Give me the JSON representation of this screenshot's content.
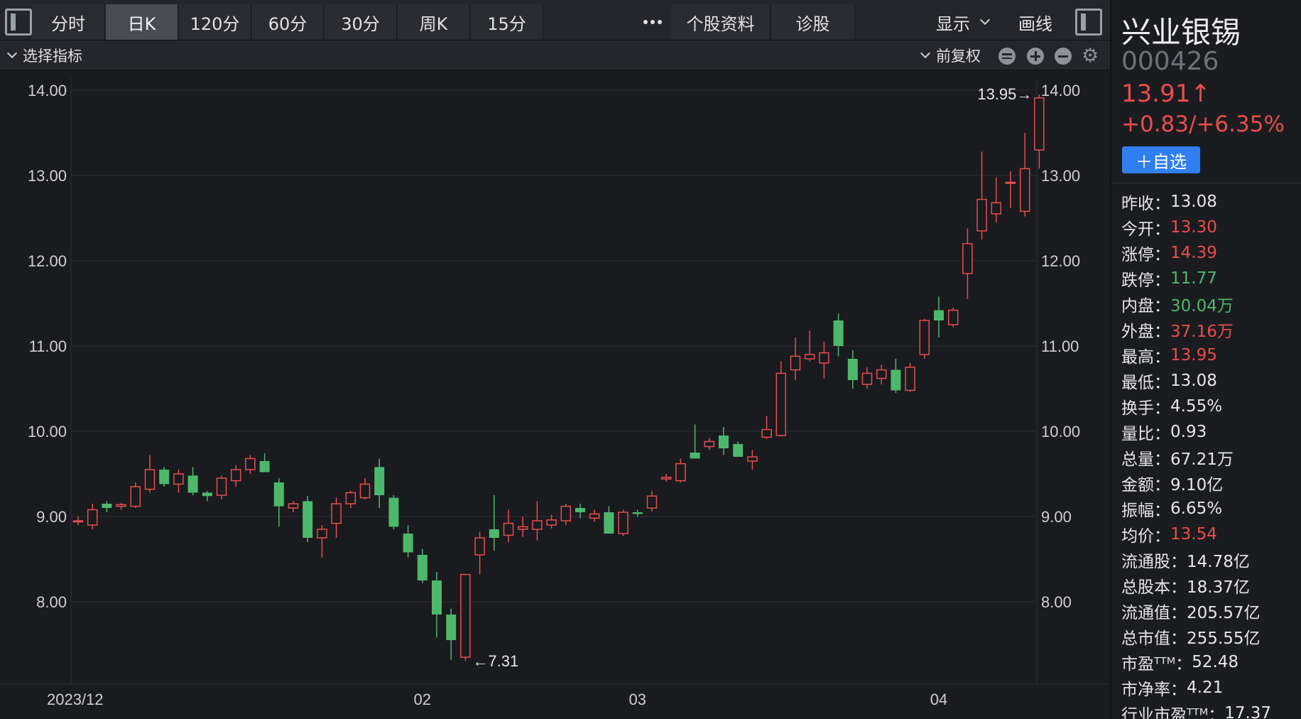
{
  "toolbar": {
    "tabs": [
      {
        "label": "分时",
        "active": false
      },
      {
        "label": "日K",
        "active": true
      },
      {
        "label": "120分",
        "active": false
      },
      {
        "label": "60分",
        "active": false
      },
      {
        "label": "30分",
        "active": false
      },
      {
        "label": "周K",
        "active": false
      },
      {
        "label": "15分",
        "active": false
      }
    ],
    "more_icon": "ellipsis-icon",
    "profile_label": "个股资料",
    "diagnose_label": "诊股",
    "display_label": "显示",
    "draw_label": "画线"
  },
  "indicator_bar": {
    "select_label": "选择指标",
    "adjust_label": "前复权",
    "icons": [
      "layers-icon",
      "zoom-in-icon",
      "zoom-out-icon",
      "gear-icon"
    ]
  },
  "stock": {
    "name": "兴业银锡",
    "code": "000426",
    "price": "13.91↑",
    "change": "+0.83/+6.35%",
    "add_watch_label": "＋自选",
    "colors": {
      "up": "#e84d4d",
      "down": "#4db86c",
      "accent": "#2f7ff0"
    }
  },
  "stats": [
    {
      "k": "昨收：",
      "v": "13.08",
      "t": "n"
    },
    {
      "k": "今开：",
      "v": "13.30",
      "t": "up"
    },
    {
      "k": "涨停：",
      "v": "14.39",
      "t": "up"
    },
    {
      "k": "跌停：",
      "v": "11.77",
      "t": "down"
    },
    {
      "k": "内盘：",
      "v": "30.04万",
      "t": "down"
    },
    {
      "k": "外盘：",
      "v": "37.16万",
      "t": "up"
    },
    {
      "k": "最高：",
      "v": "13.95",
      "t": "up"
    },
    {
      "k": "最低：",
      "v": "13.08",
      "t": "n"
    },
    {
      "k": "换手：",
      "v": "4.55%",
      "t": "n"
    },
    {
      "k": "量比：",
      "v": "0.93",
      "t": "n"
    },
    {
      "k": "总量：",
      "v": "67.21万",
      "t": "n"
    },
    {
      "k": "金额：",
      "v": "9.10亿",
      "t": "n"
    },
    {
      "k": "振幅：",
      "v": "6.65%",
      "t": "n"
    },
    {
      "k": "均价：",
      "v": "13.54",
      "t": "up"
    },
    {
      "k": "流通股：",
      "v": "14.78亿",
      "t": "n"
    },
    {
      "k": "总股本：",
      "v": "18.37亿",
      "t": "n"
    },
    {
      "k": "流通值：",
      "v": "205.57亿",
      "t": "n"
    },
    {
      "k": "总市值：",
      "v": "255.55亿",
      "t": "n"
    },
    {
      "k": "市盈ᵀᵀᴹ：",
      "v": "52.48",
      "t": "n"
    },
    {
      "k": "市净率：",
      "v": "4.21",
      "t": "n"
    },
    {
      "k": "行业市盈ᵀᵀᴹ：",
      "v": "17.37",
      "t": "n"
    }
  ],
  "chart_data": {
    "type": "candlestick",
    "ylim": [
      7.2,
      14.2
    ],
    "y_ticks": [
      "14.00",
      "13.00",
      "12.00",
      "11.00",
      "10.00",
      "9.00",
      "8.00"
    ],
    "x_labels": [
      {
        "label": "2023/12",
        "index": 0
      },
      {
        "label": "02",
        "index": 24
      },
      {
        "label": "03",
        "index": 39
      },
      {
        "label": "04",
        "index": 60
      }
    ],
    "high_label": "13.95→",
    "low_label": "←7.31",
    "colors": {
      "up": "#e84d4d",
      "down": "#4db86c"
    },
    "candles": [
      {
        "o": 8.95,
        "h": 9.0,
        "l": 8.9,
        "c": 8.95
      },
      {
        "o": 8.9,
        "h": 9.15,
        "l": 8.85,
        "c": 9.08
      },
      {
        "o": 9.15,
        "h": 9.18,
        "l": 9.05,
        "c": 9.1
      },
      {
        "o": 9.12,
        "h": 9.16,
        "l": 9.08,
        "c": 9.14
      },
      {
        "o": 9.12,
        "h": 9.4,
        "l": 9.1,
        "c": 9.35
      },
      {
        "o": 9.32,
        "h": 9.72,
        "l": 9.28,
        "c": 9.55
      },
      {
        "o": 9.55,
        "h": 9.58,
        "l": 9.35,
        "c": 9.38
      },
      {
        "o": 9.38,
        "h": 9.55,
        "l": 9.28,
        "c": 9.5
      },
      {
        "o": 9.48,
        "h": 9.58,
        "l": 9.25,
        "c": 9.28
      },
      {
        "o": 9.28,
        "h": 9.3,
        "l": 9.18,
        "c": 9.24
      },
      {
        "o": 9.25,
        "h": 9.48,
        "l": 9.2,
        "c": 9.45
      },
      {
        "o": 9.42,
        "h": 9.6,
        "l": 9.35,
        "c": 9.55
      },
      {
        "o": 9.55,
        "h": 9.72,
        "l": 9.5,
        "c": 9.68
      },
      {
        "o": 9.65,
        "h": 9.74,
        "l": 9.52,
        "c": 9.52
      },
      {
        "o": 9.4,
        "h": 9.45,
        "l": 8.88,
        "c": 9.12
      },
      {
        "o": 9.1,
        "h": 9.18,
        "l": 9.05,
        "c": 9.15
      },
      {
        "o": 9.18,
        "h": 9.24,
        "l": 8.7,
        "c": 8.75
      },
      {
        "o": 8.75,
        "h": 8.9,
        "l": 8.52,
        "c": 8.85
      },
      {
        "o": 8.92,
        "h": 9.22,
        "l": 8.75,
        "c": 9.15
      },
      {
        "o": 9.15,
        "h": 9.3,
        "l": 9.1,
        "c": 9.28
      },
      {
        "o": 9.22,
        "h": 9.45,
        "l": 9.2,
        "c": 9.38
      },
      {
        "o": 9.58,
        "h": 9.68,
        "l": 9.1,
        "c": 9.25
      },
      {
        "o": 9.22,
        "h": 9.25,
        "l": 8.85,
        "c": 8.88
      },
      {
        "o": 8.8,
        "h": 8.9,
        "l": 8.52,
        "c": 8.58
      },
      {
        "o": 8.55,
        "h": 8.62,
        "l": 8.22,
        "c": 8.25
      },
      {
        "o": 8.25,
        "h": 8.35,
        "l": 7.58,
        "c": 7.85
      },
      {
        "o": 7.85,
        "h": 7.92,
        "l": 7.32,
        "c": 7.55
      },
      {
        "o": 7.35,
        "h": 8.32,
        "l": 7.31,
        "c": 8.32
      },
      {
        "o": 8.55,
        "h": 8.82,
        "l": 8.32,
        "c": 8.75
      },
      {
        "o": 8.85,
        "h": 9.25,
        "l": 8.6,
        "c": 8.75
      },
      {
        "o": 8.78,
        "h": 9.08,
        "l": 8.7,
        "c": 8.92
      },
      {
        "o": 8.85,
        "h": 9.0,
        "l": 8.76,
        "c": 8.88
      },
      {
        "o": 8.85,
        "h": 9.18,
        "l": 8.72,
        "c": 8.95
      },
      {
        "o": 8.9,
        "h": 9.02,
        "l": 8.86,
        "c": 8.96
      },
      {
        "o": 8.95,
        "h": 9.15,
        "l": 8.9,
        "c": 9.12
      },
      {
        "o": 9.1,
        "h": 9.15,
        "l": 8.98,
        "c": 9.05
      },
      {
        "o": 8.98,
        "h": 9.08,
        "l": 8.94,
        "c": 9.03
      },
      {
        "o": 9.05,
        "h": 9.12,
        "l": 8.8,
        "c": 8.8
      },
      {
        "o": 8.8,
        "h": 9.08,
        "l": 8.77,
        "c": 9.05
      },
      {
        "o": 9.05,
        "h": 9.08,
        "l": 9.0,
        "c": 9.03
      },
      {
        "o": 9.1,
        "h": 9.3,
        "l": 9.06,
        "c": 9.24
      },
      {
        "o": 9.44,
        "h": 9.5,
        "l": 9.41,
        "c": 9.46
      },
      {
        "o": 9.42,
        "h": 9.68,
        "l": 9.4,
        "c": 9.62
      },
      {
        "o": 9.75,
        "h": 10.08,
        "l": 9.68,
        "c": 9.68
      },
      {
        "o": 9.82,
        "h": 9.92,
        "l": 9.78,
        "c": 9.88
      },
      {
        "o": 9.95,
        "h": 10.05,
        "l": 9.72,
        "c": 9.8
      },
      {
        "o": 9.85,
        "h": 9.88,
        "l": 9.7,
        "c": 9.7
      },
      {
        "o": 9.65,
        "h": 9.78,
        "l": 9.55,
        "c": 9.7
      },
      {
        "o": 9.93,
        "h": 10.18,
        "l": 9.91,
        "c": 10.02
      },
      {
        "o": 9.95,
        "h": 10.82,
        "l": 9.94,
        "c": 10.68
      },
      {
        "o": 10.72,
        "h": 11.1,
        "l": 10.6,
        "c": 10.88
      },
      {
        "o": 10.85,
        "h": 11.18,
        "l": 10.82,
        "c": 10.9
      },
      {
        "o": 10.8,
        "h": 11.05,
        "l": 10.62,
        "c": 10.92
      },
      {
        "o": 11.3,
        "h": 11.38,
        "l": 10.88,
        "c": 11.0
      },
      {
        "o": 10.85,
        "h": 10.95,
        "l": 10.5,
        "c": 10.6
      },
      {
        "o": 10.55,
        "h": 10.75,
        "l": 10.5,
        "c": 10.68
      },
      {
        "o": 10.62,
        "h": 10.78,
        "l": 10.55,
        "c": 10.72
      },
      {
        "o": 10.72,
        "h": 10.85,
        "l": 10.45,
        "c": 10.48
      },
      {
        "o": 10.48,
        "h": 10.8,
        "l": 10.46,
        "c": 10.75
      },
      {
        "o": 10.9,
        "h": 11.32,
        "l": 10.85,
        "c": 11.3
      },
      {
        "o": 11.42,
        "h": 11.58,
        "l": 11.1,
        "c": 11.3
      },
      {
        "o": 11.25,
        "h": 11.45,
        "l": 11.22,
        "c": 11.42
      },
      {
        "o": 11.85,
        "h": 12.38,
        "l": 11.55,
        "c": 12.2
      },
      {
        "o": 12.35,
        "h": 13.28,
        "l": 12.25,
        "c": 12.72
      },
      {
        "o": 12.55,
        "h": 12.98,
        "l": 12.45,
        "c": 12.68
      },
      {
        "o": 12.92,
        "h": 13.05,
        "l": 12.62,
        "c": 12.92
      },
      {
        "o": 12.58,
        "h": 13.5,
        "l": 12.52,
        "c": 13.08
      },
      {
        "o": 13.3,
        "h": 13.95,
        "l": 13.08,
        "c": 13.91
      }
    ]
  }
}
